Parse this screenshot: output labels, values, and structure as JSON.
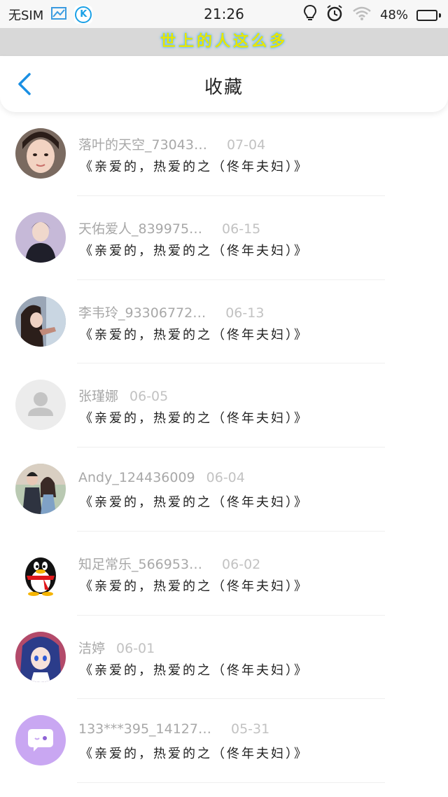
{
  "status_bar": {
    "sim": "无SIM",
    "time": "21:26",
    "battery": "48%",
    "app_icon_letter": "K",
    "icons": [
      "gallery-icon",
      "k-app-icon",
      "bulb-icon",
      "alarm-icon",
      "wifi-icon",
      "battery-icon"
    ]
  },
  "banner": {
    "text": "世上的人这么多"
  },
  "header": {
    "title": "收藏",
    "back_icon": "chevron-left-icon"
  },
  "items": [
    {
      "name": "落叶的天空_73043…",
      "date": "07-04",
      "text": "《亲爱的，热爱的之（佟年夫妇）》",
      "avatar": "photo-avatar"
    },
    {
      "name": "天佑爱人_839975…",
      "date": "06-15",
      "text": "《亲爱的，热爱的之（佟年夫妇）》",
      "avatar": "photo-avatar"
    },
    {
      "name": "李韦玲_93306772…",
      "date": "06-13",
      "text": "《亲爱的，热爱的之（佟年夫妇）》",
      "avatar": "photo-avatar"
    },
    {
      "name": "张瑾娜",
      "date": "06-05",
      "text": "《亲爱的，热爱的之（佟年夫妇）》",
      "avatar": "default-person-avatar"
    },
    {
      "name": "Andy_124436009",
      "date": "06-04",
      "text": "《亲爱的，热爱的之（佟年夫妇）》",
      "avatar": "photo-avatar"
    },
    {
      "name": "知足常乐_566953…",
      "date": "06-02",
      "text": "《亲爱的，热爱的之（佟年夫妇）》",
      "avatar": "penguin-avatar"
    },
    {
      "name": "洁婷",
      "date": "06-01",
      "text": "《亲爱的，热爱的之（佟年夫妇）》",
      "avatar": "anime-avatar"
    },
    {
      "name": "133***395_14127…",
      "date": "05-31",
      "text": "《亲爱的，热爱的之（佟年夫妇）》",
      "avatar": "chat-bubble-avatar"
    }
  ],
  "colors": {
    "accent": "#1a8fe3",
    "name_gray": "#a8a8a8",
    "date_gray": "#c2c2c2",
    "text": "#222222"
  }
}
